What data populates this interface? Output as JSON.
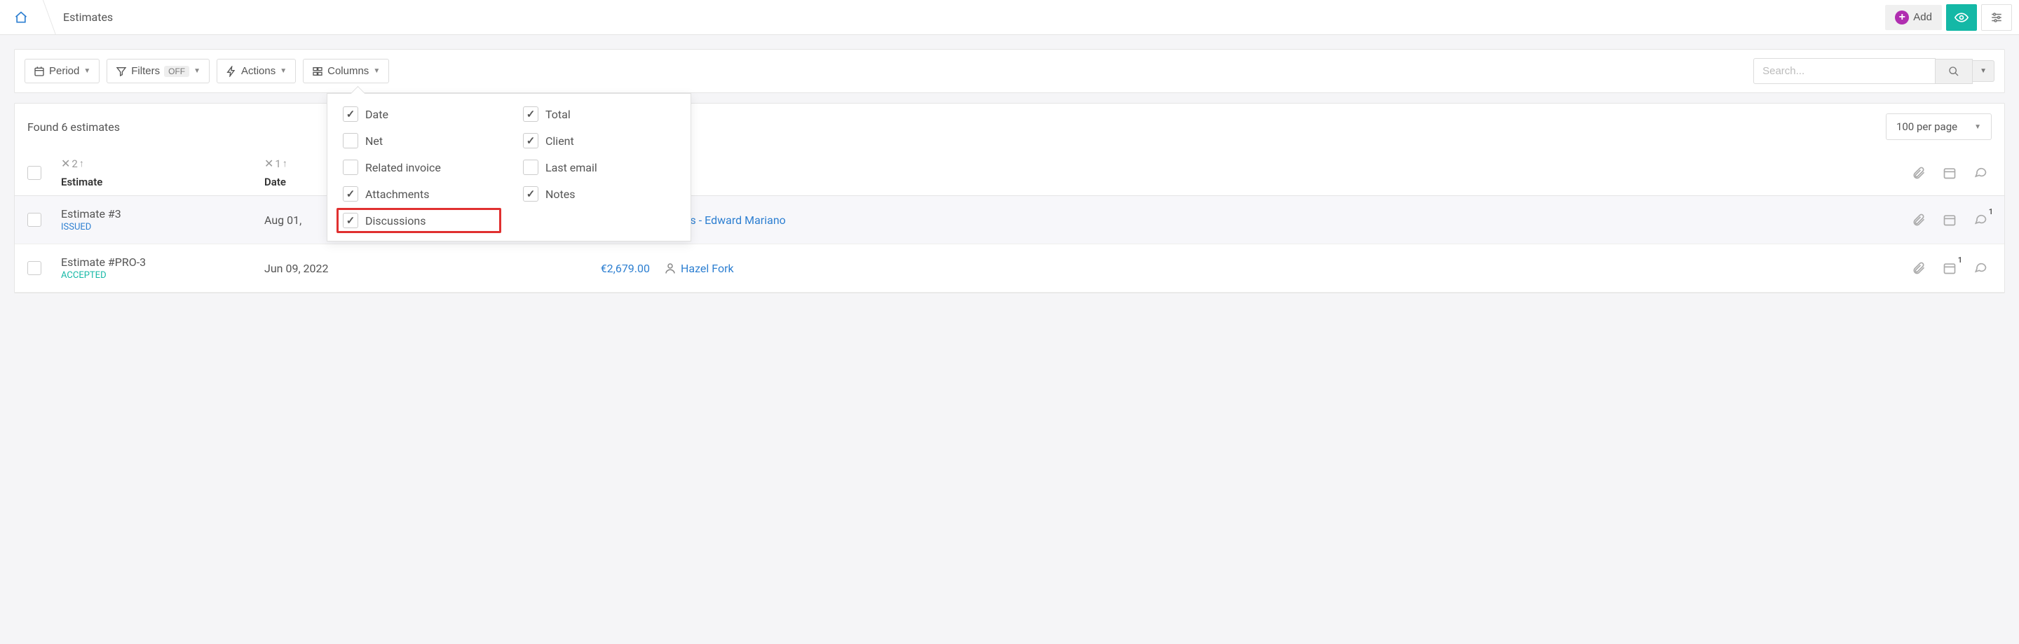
{
  "header": {
    "title": "Estimates",
    "add_label": "Add"
  },
  "toolbar": {
    "period": "Period",
    "filters": "Filters",
    "filters_badge": "OFF",
    "actions": "Actions",
    "columns": "Columns",
    "search_placeholder": "Search..."
  },
  "summary": {
    "found": "Found 6 estimates",
    "per_page": "100 per page"
  },
  "table": {
    "head": {
      "estimate": "Estimate",
      "date": "Date",
      "sort1": "2",
      "sort2": "1"
    },
    "rows": [
      {
        "name": "Estimate #3",
        "status": "ISSUED",
        "status_class": "status-issued",
        "date": "Aug 01,",
        "total": "",
        "client": "artons - Edward Mariano",
        "client_icon": false,
        "hover": true,
        "cal_badge": "",
        "disc_badge": "1"
      },
      {
        "name": "Estimate #PRO-3",
        "status": "ACCEPTED",
        "status_class": "status-accepted",
        "date": "Jun 09, 2022",
        "total": "€2,679.00",
        "client": "Hazel Fork",
        "client_icon": true,
        "hover": false,
        "cal_badge": "1",
        "disc_badge": ""
      }
    ]
  },
  "columns_dropdown": {
    "left": [
      {
        "label": "Date",
        "checked": true
      },
      {
        "label": "Net",
        "checked": false
      },
      {
        "label": "Related invoice",
        "checked": false
      },
      {
        "label": "Attachments",
        "checked": true
      },
      {
        "label": "Discussions",
        "checked": true,
        "highlight": true
      }
    ],
    "right": [
      {
        "label": "Total",
        "checked": true
      },
      {
        "label": "Client",
        "checked": true
      },
      {
        "label": "Last email",
        "checked": false
      },
      {
        "label": "Notes",
        "checked": true
      }
    ]
  }
}
